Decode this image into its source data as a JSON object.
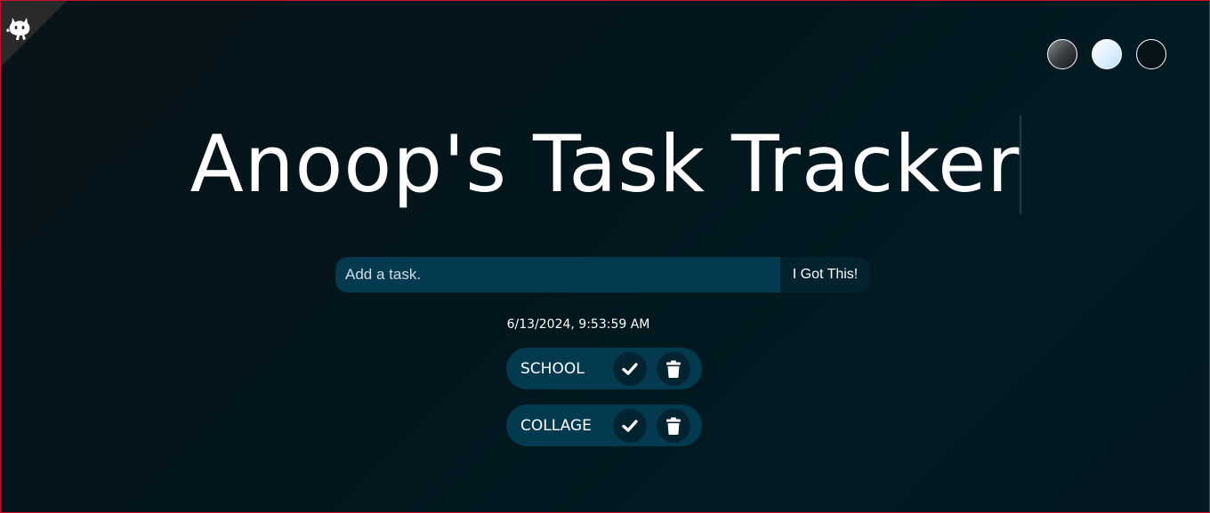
{
  "header": {
    "title": "Anoop's Task Tracker"
  },
  "corner": {
    "icon": "github-octocat-icon"
  },
  "themes": [
    {
      "name": "standard",
      "icon": "theme-standard"
    },
    {
      "name": "light",
      "icon": "theme-light"
    },
    {
      "name": "darker",
      "icon": "theme-darker"
    }
  ],
  "form": {
    "placeholder": "Add a task.",
    "value": "",
    "submit_label": "I Got This!"
  },
  "datetime": "6/13/2024, 9:53:59 AM",
  "todos": [
    {
      "text": "SCHOOL",
      "check_icon": "check-icon",
      "delete_icon": "trash-icon"
    },
    {
      "text": "COLLAGE",
      "check_icon": "check-icon",
      "delete_icon": "trash-icon"
    }
  ],
  "colors": {
    "accent": "#033a4f",
    "button_dark": "#022431",
    "frame_border": "#c8102e"
  }
}
